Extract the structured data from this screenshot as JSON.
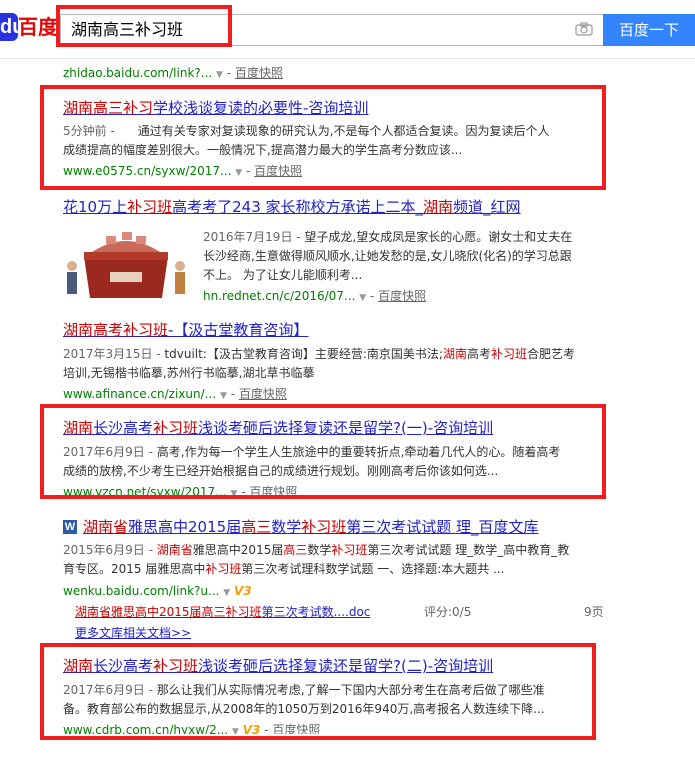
{
  "logo_text": "百度",
  "search": {
    "query": "湖南高三补习班",
    "button": "百度一下"
  },
  "top_url": {
    "url": "zhidao.baidu.com/link?...",
    "snapshot": "百度快照"
  },
  "result1": {
    "title_parts": [
      "湖南高三补习",
      "学校浅谈复读的必要性-咨询培训"
    ],
    "date": "5分钟前",
    "sep": " - ",
    "desc_line1": "通过有关专家对复读现象的研究认为,不是每个人都适合复读。因为复读后个人",
    "desc_line2": "成绩提高的幅度差别很大。一般情况下,提高潜力最大的学生高考分数应该...",
    "url": "www.e0575.cn/syxw/2017...",
    "snapshot": "百度快照"
  },
  "result2": {
    "title_parts": [
      "花10万上",
      "补习班",
      "高考考了243 家长称校方承诺上二本_",
      "湖南",
      "频道_红网"
    ],
    "date": "2016年7月19日",
    "desc_line1": "望子成龙,望女成凤是家长的心愿。谢女士和丈夫在",
    "desc_line2": "长沙经商,生意做得顺风顺水,让她发愁的是,女儿晓欣(化名)的学习总跟",
    "desc_line3": "不上。 为了让女儿能顺利考...",
    "url": "hn.rednet.cn/c/2016/07...",
    "snapshot": "百度快照"
  },
  "result3": {
    "title_parts": [
      "湖南高考补习班",
      "-【汲古堂教育咨询】"
    ],
    "date": "2017年3月15日",
    "desc_line1_parts": [
      "tdvuilt:【汲古堂教育咨询】主要经营:南京国美书法;",
      "湖南",
      "高考",
      "补习班",
      "合肥艺考"
    ],
    "desc_line2": "培训,无锡楷书临摹,苏州行书临摹,湖北草书临摹",
    "url": "www.afinance.cn/zixun/...",
    "snapshot": "百度快照"
  },
  "result4": {
    "title_parts": [
      "湖南",
      "长沙高考",
      "补习班",
      "浅谈考砸后选择复读还是留学?(一)-咨询培训"
    ],
    "date": "2017年6月9日",
    "desc_line1": "高考,作为每一个学生人生旅途中的重要转折点,牵动着几代人的心。随着高考",
    "desc_line2": "成绩的放榜,不少考生已经开始根据自己的成绩进行规划。刚刚高考后你该如何选...",
    "url": "www.yzcn.net/syxw/2017...",
    "snapshot": "百度快照"
  },
  "result5": {
    "icon_letter": "W",
    "title_parts": [
      "湖南省",
      "雅思高中2015届",
      "高三",
      "数学",
      "补习班",
      "第三次考试试题 理_百度文库"
    ],
    "date": "2015年6月9日",
    "desc_line1_parts": [
      "湖南省",
      "雅思高中2015届",
      "高三",
      "数学",
      "补习班",
      "第三次考试试题 理_数学_高中教育_教"
    ],
    "desc_line2_parts": [
      "育专区。2015 届雅思高中",
      "补习班",
      "第三次考试理科数学试题 一、选择题:本大题共 ..."
    ],
    "url": "wenku.baidu.com/link?u...",
    "v3": "V3",
    "doc_parts": [
      "湖南省雅思高中2015届",
      "高三补习班",
      "第三次考试数....doc"
    ],
    "score": "评分:0/5",
    "pages": "9页",
    "more_docs": "更多文库相关文档>>"
  },
  "result6": {
    "title_parts": [
      "湖南",
      "长沙高考",
      "补习班",
      "浅谈考砸后选择复读还是留学?(二)-咨询培训"
    ],
    "date": "2017年6月9日",
    "desc_line1": "那么让我们从实际情况考虑,了解一下国内大部分考生在高考后做了哪些准",
    "desc_line2": "备。教育部公布的数据显示,从2008年的1050万到2016年940万,高考报名人数连续下降...",
    "url": "www.cdrb.com.cn/hyxw/2...",
    "v3": "V3",
    "snapshot": "百度快照"
  },
  "colors": {
    "highlight_box": "#f01e1e",
    "title_link": "#2222cc",
    "keyword": "#cc0000",
    "url_green": "#008000",
    "search_button": "#3385ff"
  }
}
